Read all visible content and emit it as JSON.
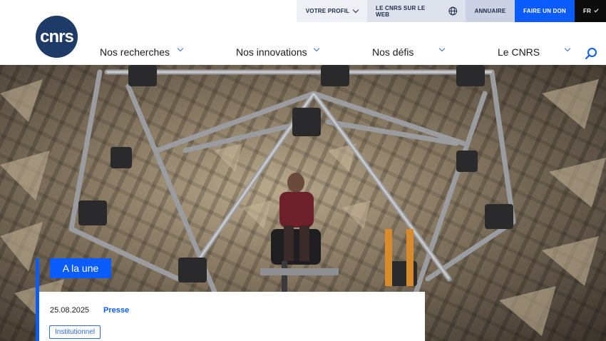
{
  "topbar": {
    "profil": "VOTRE PROFIL",
    "web": "LE CNRS SUR LE WEB",
    "annuaire": "ANNUAIRE",
    "don": "FAIRE UN DON",
    "lang": "FR"
  },
  "logo": {
    "text": "cnrs"
  },
  "nav": {
    "items": [
      {
        "label": "Nos recherches"
      },
      {
        "label": "Nos innovations"
      },
      {
        "label": "Nos défis"
      },
      {
        "label": "Le CNRS"
      }
    ]
  },
  "hero": {
    "tag": "A la une",
    "date": "25.08.2025",
    "type": "Presse",
    "badge": "Institutionnel"
  },
  "colors": {
    "accent": "#0a5cff",
    "logo_bg": "#1e3a66",
    "lang_bg": "#0c0c0c"
  },
  "icons": [
    "chevron-down-icon",
    "globe-icon",
    "search-icon"
  ]
}
